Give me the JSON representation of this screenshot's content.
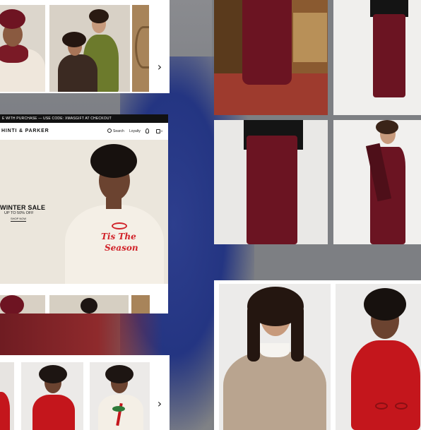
{
  "colors": {
    "background_grey": "#7d7f83",
    "banner_black": "#111111",
    "velvet_burgundy": "#6b1422",
    "cardigan_red": "#c4161c",
    "sweater_cream": "#f4efe6",
    "royal_blue": "#243582",
    "oatmeal": "#b9a48f"
  },
  "site": {
    "banner_text": "E WITH PURCHASE — USE CODE: XMASGIFT AT CHECKOUT",
    "brand": "HINTI & PARKER",
    "nav_search": "Search",
    "nav_loyalty": "Loyalty",
    "cart_count": "0"
  },
  "hero": {
    "title": "WINTER SALE",
    "subtitle": "UP TO 50% OFF",
    "cta": "SHOP NOW",
    "sweater_text_line1": "Tis The",
    "sweater_text_line2": "Season"
  },
  "icons": {
    "next_top": "chevron-right-icon",
    "next_bottom": "chevron-right-icon",
    "search": "search-icon",
    "account": "user-icon",
    "bag": "shopping-bag-icon",
    "top_next_glyph": "›",
    "bottom_next_glyph": "›"
  }
}
